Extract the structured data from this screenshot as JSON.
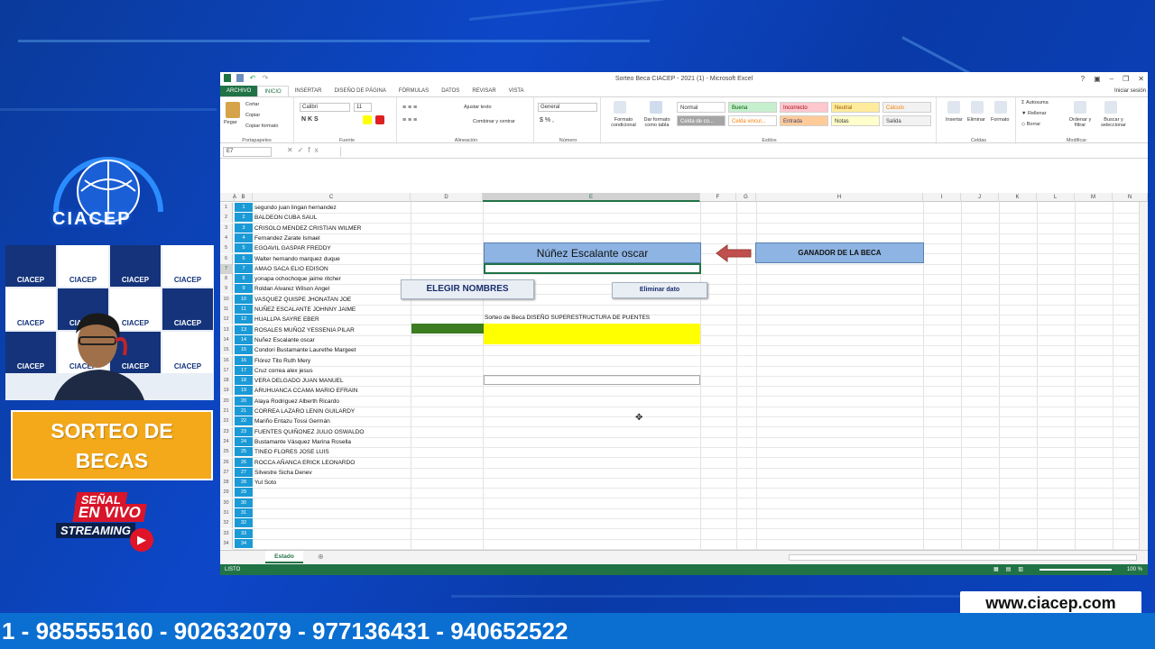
{
  "overlay": {
    "logo_text": "CIACEP",
    "promo_label_line1": "SORTEO DE",
    "promo_label_line2": "BECAS",
    "live_line1": "SEÑAL",
    "live_line2": "EN VIVO",
    "live_line3": "STREAMING",
    "website": "www.ciacep.com",
    "ticker": "1 - 985555160 - 902632079 - 977136431 - 940652522",
    "camera_tile_text": "CIACEP"
  },
  "excel": {
    "title": "Sorteo Beca CIACEP - 2021 (1) - Microsoft Excel",
    "tabs": [
      "ARCHIVO",
      "INICIO",
      "INSERTAR",
      "DISEÑO DE PÁGINA",
      "FÓRMULAS",
      "DATOS",
      "REVISAR",
      "VISTA"
    ],
    "signin": "Iniciar sesión",
    "ribbon": {
      "paste": "Pegar",
      "cut": "Cortar",
      "copy": "Copiar",
      "format_painter": "Copiar formato",
      "clipboard_group": "Portapapeles",
      "font_name": "Calibri",
      "font_size": "11",
      "font_group": "Fuente",
      "wrap": "Ajustar texto",
      "merge": "Combinar y centrar",
      "align_group": "Alineación",
      "number_format": "General",
      "number_group": "Número",
      "cond_format": "Formato condicional",
      "as_table": "Dar formato como tabla",
      "styles": [
        "Normal",
        "Buena",
        "Incorrecto",
        "Neutral",
        "Cálculo",
        "Celda de co...",
        "Celda vincul...",
        "Entrada",
        "Notas",
        "Salida"
      ],
      "styles_group": "Estilos",
      "insert": "Insertar",
      "delete": "Eliminar",
      "format": "Formato",
      "cells_group": "Celdas",
      "autosum": "Autosuma",
      "fill": "Rellenar",
      "clear": "Borrar",
      "sort": "Ordenar y filtrar",
      "find": "Buscar y seleccionar",
      "edit_group": "Modificar"
    },
    "name_box": "E7",
    "columns": [
      "A",
      "B",
      "C",
      "D",
      "E",
      "F",
      "G",
      "H",
      "I",
      "J",
      "K",
      "L",
      "M",
      "N"
    ],
    "rows": [
      {
        "n": "1",
        "name": "segundo juan lingan hernandez"
      },
      {
        "n": "2",
        "name": "BALDEON CUBA SAUL"
      },
      {
        "n": "3",
        "name": "CRISOLO MENDEZ CRISTIAN WILMER"
      },
      {
        "n": "4",
        "name": "Fernandez Zarate Ismael"
      },
      {
        "n": "5",
        "name": "EGOAVIL GASPAR FREDDY"
      },
      {
        "n": "6",
        "name": "Walter hernando marquez duque"
      },
      {
        "n": "7",
        "name": "AMAO SACA ELIO EDISON"
      },
      {
        "n": "8",
        "name": "yonapa ochochoque jaime ritcher"
      },
      {
        "n": "9",
        "name": "Roldan Alvarez Wilson Angel"
      },
      {
        "n": "10",
        "name": "VASQUEZ QUISPE JHONATAN JOE"
      },
      {
        "n": "11",
        "name": "NUÑEZ ESCALANTE JOHNNY JAIME"
      },
      {
        "n": "12",
        "name": "HUALLPA SAYRE EBER"
      },
      {
        "n": "13",
        "name": "ROSALES MUÑOZ YESSENIA PILAR"
      },
      {
        "n": "14",
        "name": "Nuñez Escalante oscar"
      },
      {
        "n": "15",
        "name": "Condori Bustamante Laurethe Margeet"
      },
      {
        "n": "16",
        "name": "Flórez Tito Ruth Mery"
      },
      {
        "n": "17",
        "name": "Cruz correa alex jesus"
      },
      {
        "n": "18",
        "name": "VERA DELGADO JUAN MANUEL"
      },
      {
        "n": "19",
        "name": "ARUHUANCA CCAMA MARIO EFRAIN"
      },
      {
        "n": "20",
        "name": "Alaya Rodriguez Alberth Ricardo"
      },
      {
        "n": "21",
        "name": "CORREA LAZARO LENIN GUILARDY"
      },
      {
        "n": "22",
        "name": "Mariño Entazu Tossi Germán"
      },
      {
        "n": "23",
        "name": "FUENTES QUIÑONEZ JULIO OSWALDO"
      },
      {
        "n": "24",
        "name": "Bustamante Vásquez Marina Rosella"
      },
      {
        "n": "25",
        "name": "TINEO FLORES JOSE LUIS"
      },
      {
        "n": "26",
        "name": "ROCCA AÑANCA ERICK LEONARDO"
      },
      {
        "n": "27",
        "name": "Silvestre Sicha Denev"
      },
      {
        "n": "28",
        "name": "Yul Soto"
      },
      {
        "n": "29",
        "name": ""
      },
      {
        "n": "30",
        "name": ""
      },
      {
        "n": "31",
        "name": ""
      },
      {
        "n": "32",
        "name": ""
      },
      {
        "n": "33",
        "name": ""
      },
      {
        "n": "34",
        "name": ""
      }
    ],
    "winner": "Núñez Escalante oscar",
    "winner_label": "GANADOR DE LA BECA",
    "pick_button": "ELEGIR NOMBRES",
    "delete_button": "Eliminar dato",
    "raffle_title": "Sorteo de Beca DISEÑO SUPERESTRUCTURA DE PUENTES",
    "sheet_tab": "Estado",
    "status": "LISTO",
    "zoom": "100 %",
    "colors": {
      "excel_green": "#217346",
      "blue_cells": "#1b9ad6",
      "yellow": "#ffff00",
      "winner_box": "#8eb4e3",
      "arrow": "#c0504d",
      "green_block": "#3c7d22"
    }
  }
}
